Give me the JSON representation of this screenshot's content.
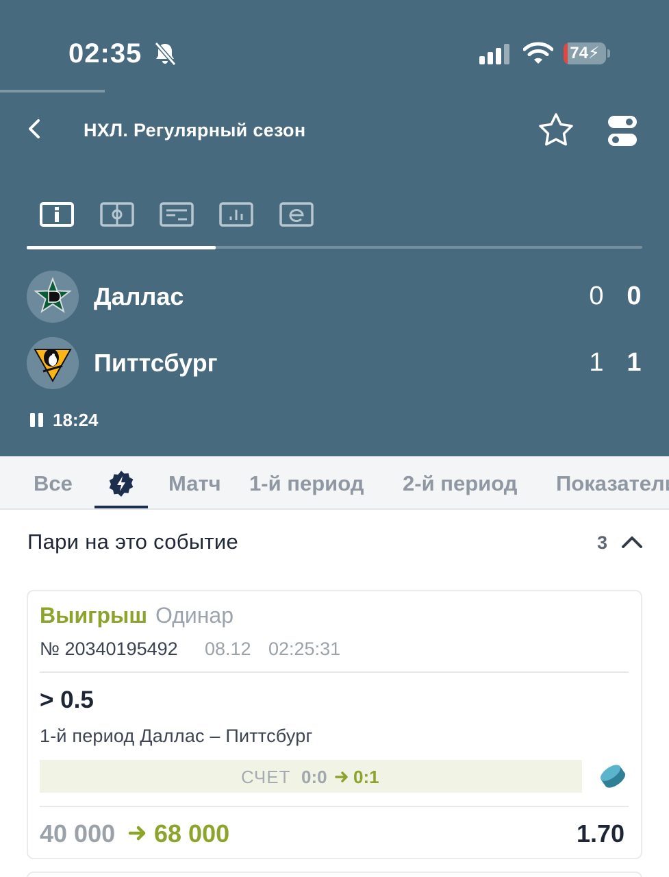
{
  "status_bar": {
    "time": "02:35",
    "battery": "74",
    "icons": [
      "bell-slash-icon",
      "cellular-signal-icon",
      "wifi-icon",
      "battery-charging-icon"
    ]
  },
  "header": {
    "title": "НХЛ. Регулярный сезон",
    "icons": [
      "chevron-left-icon",
      "star-icon",
      "toggle-icon"
    ]
  },
  "view_tabs": [
    {
      "icon": "info-icon",
      "active": true
    },
    {
      "icon": "field-icon",
      "active": false
    },
    {
      "icon": "lineup-icon",
      "active": false
    },
    {
      "icon": "stats-icon",
      "active": false
    },
    {
      "icon": "commentary-icon",
      "active": false
    }
  ],
  "match": {
    "home": {
      "name": "Даллас",
      "period_score": "0",
      "total_score": "0",
      "logo": "dallas-stars-logo"
    },
    "away": {
      "name": "Питтсбург",
      "period_score": "1",
      "total_score": "1",
      "logo": "pittsburgh-penguins-logo"
    },
    "clock": "18:24",
    "state_icon": "pause-icon"
  },
  "filters": {
    "all": "Все",
    "match": "Матч",
    "period1": "1-й период",
    "period2": "2-й период",
    "stats": "Показатели",
    "active": "live",
    "live_icon": "lightning-badge-icon"
  },
  "bets_section": {
    "title": "Пари на это событие",
    "count": "3",
    "icon": "chevron-up-icon"
  },
  "bet": {
    "status": "Выигрыш",
    "type": "Одинар",
    "number": "№ 20340195492",
    "date": "08.12",
    "time": "02:25:31",
    "outcome": "> 0.5",
    "event": "1-й период Даллас – Питтсбург",
    "score_label": "СЧЕТ",
    "score_from": "0:0",
    "score_to": "0:1",
    "stake": "40 000",
    "payout": "68 000",
    "odds": "1.70",
    "sport_icon": "hockey-puck-icon"
  },
  "colors": {
    "header_bg": "#476a7f",
    "win_green": "#8ca32c",
    "dark_text": "#1e2535"
  }
}
